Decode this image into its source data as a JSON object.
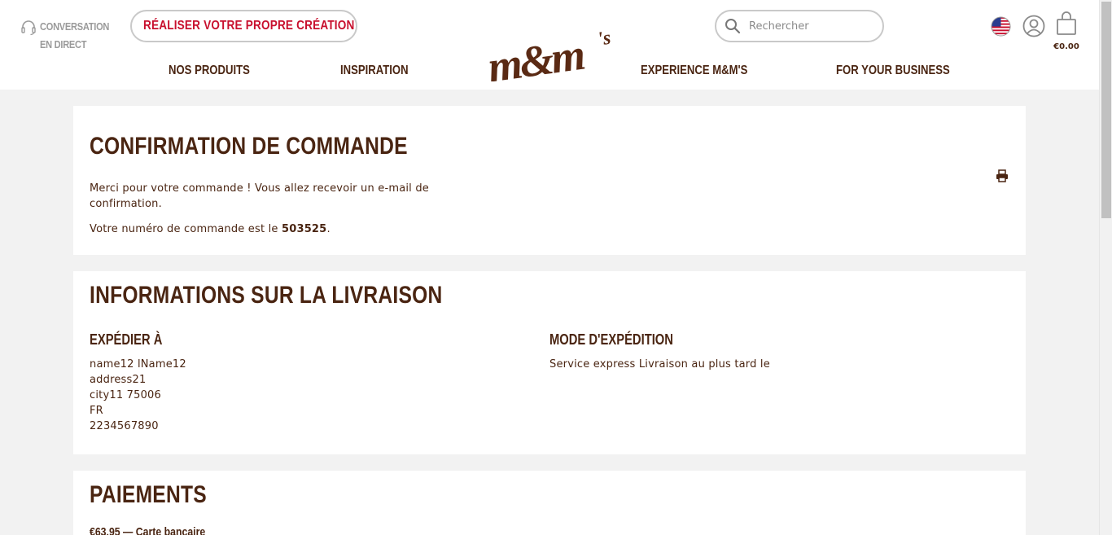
{
  "header": {
    "live_chat": "CONVERSATION EN DIRECT",
    "create_button": "RÉALISER VOTRE PROPRE CRÉATION",
    "search_placeholder": "Rechercher",
    "cart_total": "€0.00",
    "nav": [
      "NOS PRODUITS",
      "INSPIRATION",
      "EXPERIENCE M&M'S",
      "FOR YOUR BUSINESS"
    ]
  },
  "confirmation": {
    "title": "CONFIRMATION DE COMMANDE",
    "thanks_line1": "Merci pour votre commande ! Vous allez recevoir un e-mail de",
    "thanks_line2": "confirmation.",
    "order_prefix": "Votre numéro de commande est le ",
    "order_number": "503525",
    "order_suffix": "."
  },
  "delivery": {
    "title": "INFORMATIONS SUR LA LIVRAISON",
    "ship_to_title": "EXPÉDIER À",
    "ship_to_lines": [
      "name12 lName12",
      "address21",
      "city11 75006",
      "FR",
      "2234567890"
    ],
    "method_title": "MODE D'EXPÉDITION",
    "method_text": "Service express Livraison au plus tard le"
  },
  "payments": {
    "title": "PAIEMENTS",
    "line": "€63.95 — Carte bancaire"
  },
  "colors": {
    "brand_brown": "#4a2512",
    "brand_red": "#c8102e",
    "background": "#f2f2f2"
  },
  "icons": [
    "headset-icon",
    "mm-candy-icon",
    "search-icon",
    "us-flag-icon",
    "account-icon",
    "shopping-bag-icon",
    "print-icon"
  ]
}
